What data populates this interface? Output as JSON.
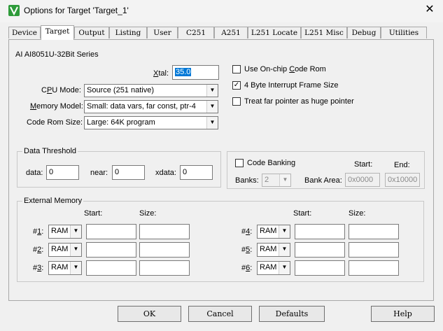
{
  "window": {
    "title": "Options for Target 'Target_1'"
  },
  "tabs": [
    "Device",
    "Target",
    "Output",
    "Listing",
    "User",
    "C251",
    "A251",
    "L251 Locate",
    "L251 Misc",
    "Debug",
    "Utilities"
  ],
  "device_name": "AI AI8051U-32Bit Series",
  "xtal": {
    "label_u": "X",
    "label_rest": "tal:",
    "value": "35.0"
  },
  "cpu_mode": {
    "label_pre": "C",
    "label_u": "P",
    "label_post": "U Mode:",
    "value": "Source (251 native)"
  },
  "memory_model": {
    "label_u": "M",
    "label_post": "emory Model:",
    "value": "Small: data vars, far const, ptr-4"
  },
  "code_rom_size": {
    "label": "Code Rom Size:",
    "value": "Large: 64K program"
  },
  "options": {
    "onchip": {
      "label_pre": "Use On-chip ",
      "label_u": "C",
      "label_post": "ode Rom",
      "checked": false
    },
    "interrupt": {
      "label": "4 Byte Interrupt Frame Size",
      "checked": true
    },
    "far_pointer": {
      "label": "Treat far pointer as huge pointer",
      "checked": false
    }
  },
  "data_threshold": {
    "title": "Data Threshold",
    "data_label": "data:",
    "data_value": "0",
    "near_label": "near:",
    "near_value": "0",
    "xdata_label": "xdata:",
    "xdata_value": "0"
  },
  "code_banking": {
    "label": "Code Banking",
    "checked": false,
    "start_label": "Start:",
    "end_label": "End:",
    "banks_label": "Banks:",
    "banks_value": "2",
    "bank_area_label": "Bank Area:",
    "start_value": "0x0000",
    "end_value": "0x10000"
  },
  "external_memory": {
    "title": "External Memory",
    "start_label": "Start:",
    "size_label": "Size:",
    "left": [
      {
        "num": "1",
        "prefix": "#",
        "suffix": ":",
        "type": "RAM"
      },
      {
        "num": "2",
        "prefix": "#",
        "suffix": ":",
        "type": "RAM"
      },
      {
        "num": "3",
        "prefix": "#",
        "suffix": ":",
        "type": "RAM"
      }
    ],
    "right": [
      {
        "num": "4",
        "prefix": "#",
        "suffix": ":",
        "type": "RAM"
      },
      {
        "num": "5",
        "prefix": "#",
        "suffix": ":",
        "type": "RAM"
      },
      {
        "num": "6",
        "prefix": "#",
        "suffix": ":",
        "type": "RAM"
      }
    ]
  },
  "buttons": {
    "ok": "OK",
    "cancel": "Cancel",
    "defaults": "Defaults",
    "help": "Help"
  },
  "icons": {
    "app": "keil-app-icon",
    "close": "close-icon",
    "dropdown": "chevron-down-icon"
  },
  "colors": {
    "selection": "#0078d7",
    "app_icon": "#2e9b3a"
  }
}
